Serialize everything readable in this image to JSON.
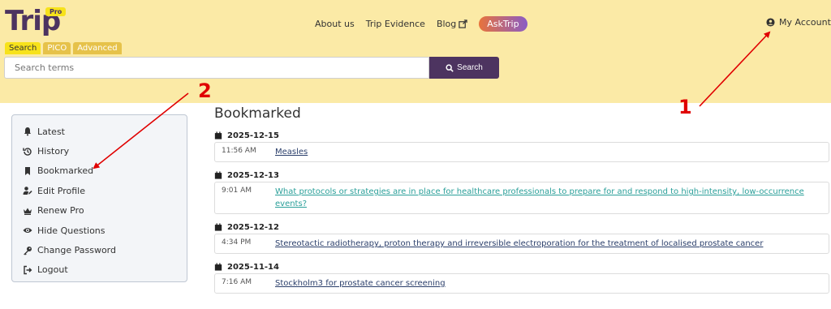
{
  "logo": {
    "text": "Trip",
    "badge": "Pro"
  },
  "nav": {
    "about": "About us",
    "evidence": "Trip Evidence",
    "blog": "Blog",
    "asktrip": "AskTrip",
    "account": "My Account"
  },
  "search": {
    "tabs": [
      "Search",
      "PICO",
      "Advanced"
    ],
    "placeholder": "Search terms",
    "button": "Search"
  },
  "sidebar": {
    "items": [
      {
        "label": "Latest",
        "icon": "bell-icon"
      },
      {
        "label": "History",
        "icon": "history-icon"
      },
      {
        "label": "Bookmarked",
        "icon": "bookmark-icon"
      },
      {
        "label": "Edit Profile",
        "icon": "user-edit-icon"
      },
      {
        "label": "Renew Pro",
        "icon": "crown-icon"
      },
      {
        "label": "Hide Questions",
        "icon": "eye-icon"
      },
      {
        "label": "Change Password",
        "icon": "key-icon"
      },
      {
        "label": "Logout",
        "icon": "logout-icon"
      }
    ]
  },
  "main": {
    "title": "Bookmarked",
    "groups": [
      {
        "date": "2025-12-15",
        "entries": [
          {
            "time": "11:56 AM",
            "title": "Measles"
          }
        ]
      },
      {
        "date": "2025-12-13",
        "entries": [
          {
            "time": "9:01 AM",
            "title": "What protocols or strategies are in place for healthcare professionals to prepare for and respond to high-intensity, low-occurrence events?"
          }
        ]
      },
      {
        "date": "2025-12-12",
        "entries": [
          {
            "time": "4:34 PM",
            "title": "Stereotactic radiotherapy, proton therapy and irreversible electroporation for the treatment of localised prostate cancer"
          }
        ]
      },
      {
        "date": "2025-11-14",
        "entries": [
          {
            "time": "7:16 AM",
            "title": "Stockholm3 for prostate cancer screening"
          }
        ]
      }
    ]
  },
  "annotations": {
    "one": "1",
    "two": "2"
  },
  "colors": {
    "header_bg": "#fbeaa6",
    "brand": "#4d3460",
    "annotation": "#e00000",
    "link": "#2b3f6b",
    "visited_link": "#2a9f99"
  }
}
